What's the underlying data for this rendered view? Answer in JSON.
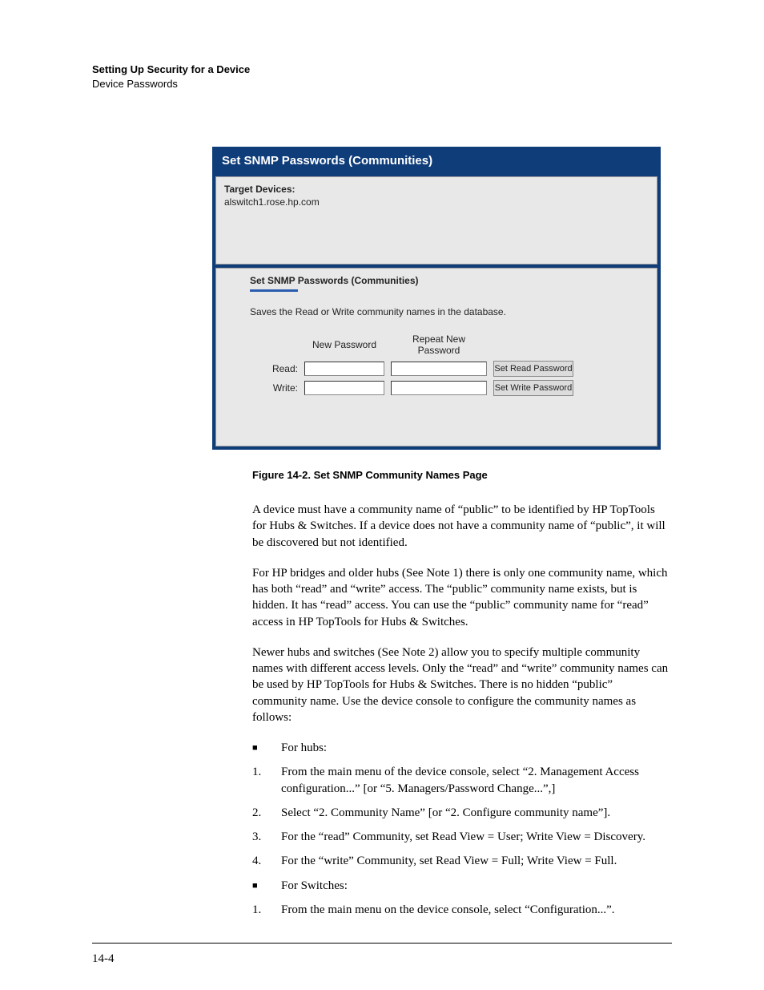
{
  "header": {
    "title": "Setting Up Security for a Device",
    "subtitle": "Device Passwords"
  },
  "panel": {
    "title": "Set SNMP Passwords (Communities)",
    "target_label": "Target Devices:",
    "target_value": "alswitch1.rose.hp.com",
    "section_title": "Set SNMP Passwords (Communities)",
    "section_desc": "Saves the Read or Write community names in the database.",
    "col1": "New Password",
    "col2": "Repeat New Password",
    "row_read": "Read:",
    "row_write": "Write:",
    "btn_read": "Set Read Password",
    "btn_write": "Set Write Password"
  },
  "caption": "Figure 14-2.  Set SNMP Community Names Page",
  "body": {
    "p1": "A device must have a community name of “public” to be identified by HP TopTools for Hubs & Switches. If a device does not have a community name of “public”, it will be discovered but not identified.",
    "p2": "For HP bridges and older hubs (See Note 1) there is only one community name, which has both “read” and “write” access. The “public” community name exists, but is hidden. It has “read” access. You can use the “public” community name for “read” access in HP TopTools for Hubs & Switches.",
    "p3": "Newer hubs and switches (See Note 2) allow you to specify multiple community names with different access levels. Only the “read” and “write” community names can be used by HP TopTools for Hubs & Switches. There is no hidden “public” community name. Use the device console to configure the community names as follows:",
    "b1": "For hubs:",
    "n1": "From the main menu of the device console, select “2. Management Access configuration...” [or “5. Managers/Password Change...”,]",
    "n2": "Select “2. Community Name” [or “2. Configure community name”].",
    "n3": "For the “read” Community, set Read View = User; Write View = Discovery.",
    "n4": "For the “write” Community, set Read View = Full; Write View = Full.",
    "b2": "For Switches:",
    "n5": "From the main menu on the device console, select “Configuration...”."
  },
  "page_number": "14-4"
}
